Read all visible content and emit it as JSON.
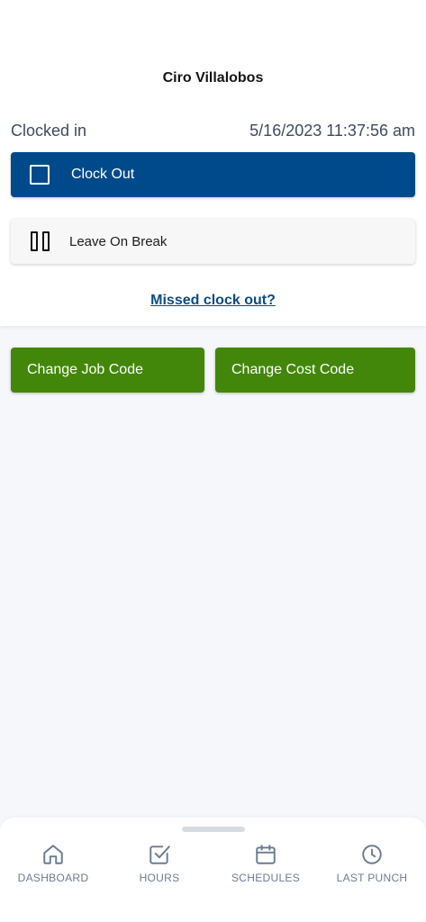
{
  "header": {
    "user_name": "Ciro Villalobos"
  },
  "status": {
    "label": "Clocked in",
    "datetime": "5/16/2023 11:37:56 am"
  },
  "actions": {
    "clock_out_label": "Clock Out",
    "break_label": "Leave On Break",
    "missed_link": "Missed clock out?",
    "change_job_label": "Change Job Code",
    "change_cost_label": "Change Cost Code"
  },
  "colors": {
    "primary": "#004a8c",
    "green": "#43870a",
    "link": "#0b4b84",
    "background": "#f5f7fb"
  },
  "nav": {
    "items": [
      {
        "label": "DASHBOARD",
        "icon": "home-icon"
      },
      {
        "label": "HOURS",
        "icon": "checkbox-icon"
      },
      {
        "label": "SCHEDULES",
        "icon": "calendar-icon"
      },
      {
        "label": "LAST PUNCH",
        "icon": "clock-icon"
      }
    ]
  }
}
